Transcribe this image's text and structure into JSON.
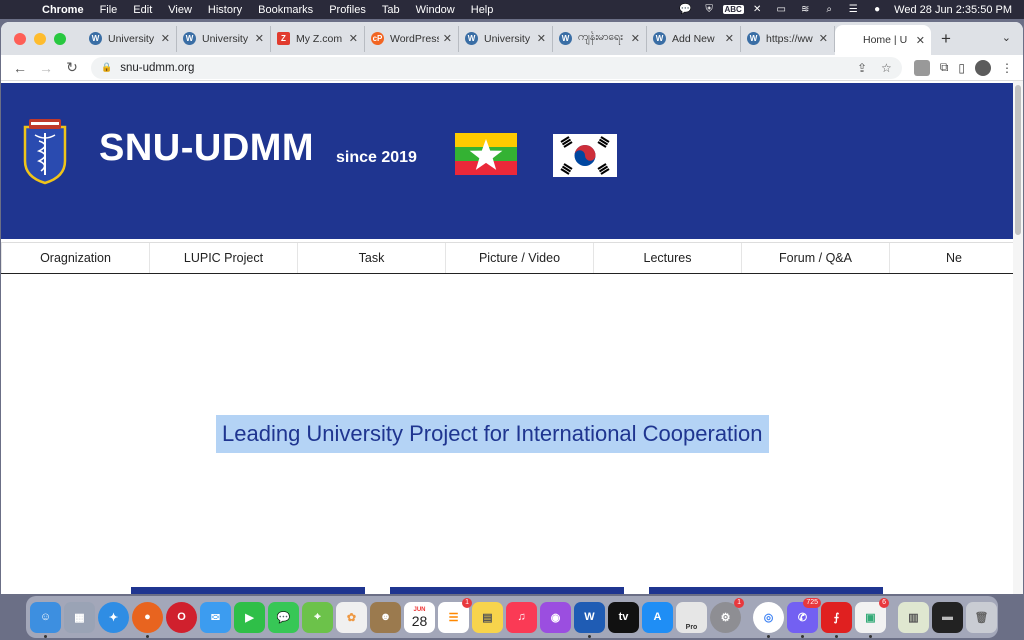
{
  "menubar": {
    "app_name": "Chrome",
    "menus": [
      "File",
      "Edit",
      "View",
      "History",
      "Bookmarks",
      "Profiles",
      "Tab",
      "Window",
      "Help"
    ],
    "input_source": "ABC",
    "clock": "Wed 28 Jun  2:35:50 PM"
  },
  "browser": {
    "tabs": [
      {
        "title": "University",
        "favicon": "wordpress-icon"
      },
      {
        "title": "University",
        "favicon": "wordpress-icon"
      },
      {
        "title": "My Z.com",
        "favicon": "z-icon"
      },
      {
        "title": "WordPress",
        "favicon": "cp-icon"
      },
      {
        "title": "University",
        "favicon": "wordpress-icon"
      },
      {
        "title": "ကျန်းမာရေး",
        "favicon": "wordpress-icon"
      },
      {
        "title": "Add New",
        "favicon": "wordpress-icon"
      },
      {
        "title": "https://ww",
        "favicon": "wordpress-icon"
      }
    ],
    "active_tab": {
      "title": "Home | U"
    },
    "url": "snu-udmm.org"
  },
  "site": {
    "title": "SNU-UDMM",
    "since": "since 2019",
    "nav": [
      "Oragnization",
      "LUPIC Project",
      "Task",
      "Picture / Video",
      "Lectures",
      "Forum / Q&A",
      "Ne"
    ],
    "tagline": "Leading University Project for International Cooperation"
  },
  "dock": {
    "calendar_month": "JUN",
    "calendar_day": "28",
    "badges": {
      "reminders": "1",
      "system_settings": "1",
      "viber": "725",
      "software_center": "6"
    },
    "word_label": "W",
    "tv_label": "tv",
    "sketch_label": "Pro"
  },
  "colors": {
    "banner": "#1f3590",
    "highlight": "#b4d3f5",
    "tagline_text": "#1f3590"
  }
}
